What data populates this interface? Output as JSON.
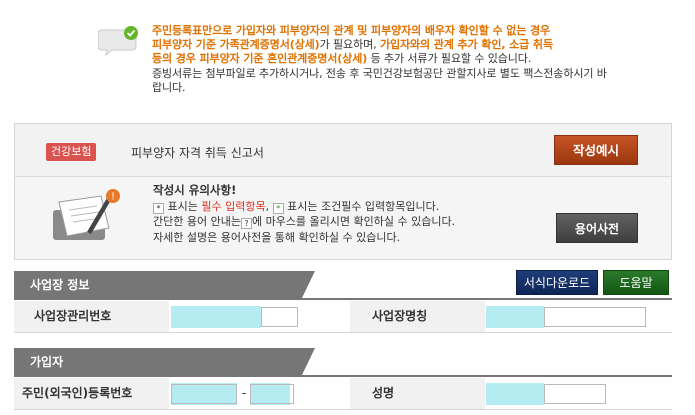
{
  "notice": {
    "line1": "주민등록표만으로 가입자와 피부양자의 관계 및 피부양자의 배우자 확인할 수 없는 경우",
    "line2a": "피부양자 기준 가족관계증명서(상세)",
    "line2b": "가 필요하며,",
    "line2c": "가입자와의 관계 추가 확인, 소급 취득",
    "line3a": "등의 경우 피부양자 기준 혼인관계증명서(상세)",
    "line3b": "등 추가 서류가 필요할 수 있습니다.",
    "line4": "증빙서류는 첨부파일로 추가하시거나, 전송 후 국민건강보험공단 관할지사로 별도 팩스전송하시기 바",
    "line5": "랍니다."
  },
  "form": {
    "badge": "건강보험",
    "title": "피부양자 자격 취득 신고서",
    "example_button": "작성예시"
  },
  "cautions": {
    "heading": "작성시 유의사항!",
    "line1_pre": "표시는",
    "line1_red": "필수 입력항목",
    "line1_mid": "표시는 조건필수 입력항목입니다.",
    "line2_pre": "간단한 용어 안내는",
    "line2_post": "에 마우스를 올리시면 확인하실 수 있습니다.",
    "line3": "자세한 설명은 용어사전을 통해 확인하실 수 있습니다.",
    "mark_required": "*",
    "mark_conditional": "*",
    "mark_help": "?",
    "dict_button": "용어사전"
  },
  "toolbar": {
    "download": "서식다운로드",
    "help": "도움말"
  },
  "workplace": {
    "section": "사업장 정보",
    "mgmt_no_label": "사업장관리번호",
    "name_label": "사업장명칭"
  },
  "subscriber": {
    "section": "가입자",
    "rrn_label": "주민(외국인)등록번호",
    "rrn_dash": "-",
    "name_label": "성명"
  },
  "colors": {
    "accent_orange": "#e17100",
    "masked": "#b5ecf1",
    "section_gray": "#767676"
  }
}
